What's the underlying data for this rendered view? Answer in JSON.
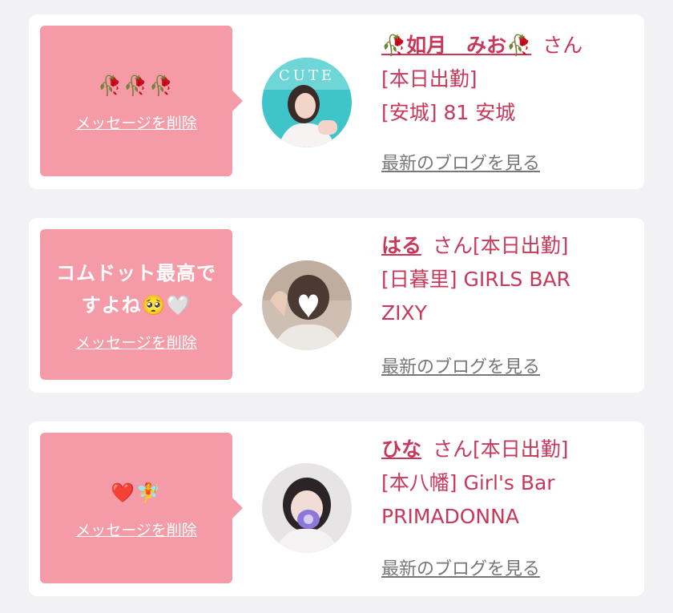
{
  "messages": [
    {
      "message": "🥀🥀🥀",
      "delete_label": "メッセージを削除",
      "girl_name": "🥀如月　みお🥀",
      "suffix": "さん",
      "status": "[本日出勤]",
      "shop_line1": "[安城] 81 安城",
      "shop_line2": "",
      "blog_label": "最新のブログを見る",
      "avatar_icon": "profile-photo",
      "avatar_text": "CUTE"
    },
    {
      "message": "コムドット最高ですよね🥺🤍",
      "delete_label": "メッセージを削除",
      "girl_name": "はる",
      "suffix": "さん[本日出勤]",
      "status": "",
      "shop_line1": "[日暮里] GIRLS BAR",
      "shop_line2": "ZIXY",
      "blog_label": "最新のブログを見る",
      "avatar_icon": "profile-photo"
    },
    {
      "message": "❤️🧚",
      "delete_label": "メッセージを削除",
      "girl_name": "ひな",
      "suffix": "さん[本日出勤]",
      "status": "",
      "shop_line1": "[本八幡] Girl's Bar",
      "shop_line2": "PRIMADONNA",
      "blog_label": "最新のブログを見る",
      "avatar_icon": "profile-photo"
    }
  ],
  "colors": {
    "bubble": "#f59aa7",
    "accent": "#c8385a",
    "link_gray": "#777777",
    "page_bg": "#f2f2f4"
  }
}
